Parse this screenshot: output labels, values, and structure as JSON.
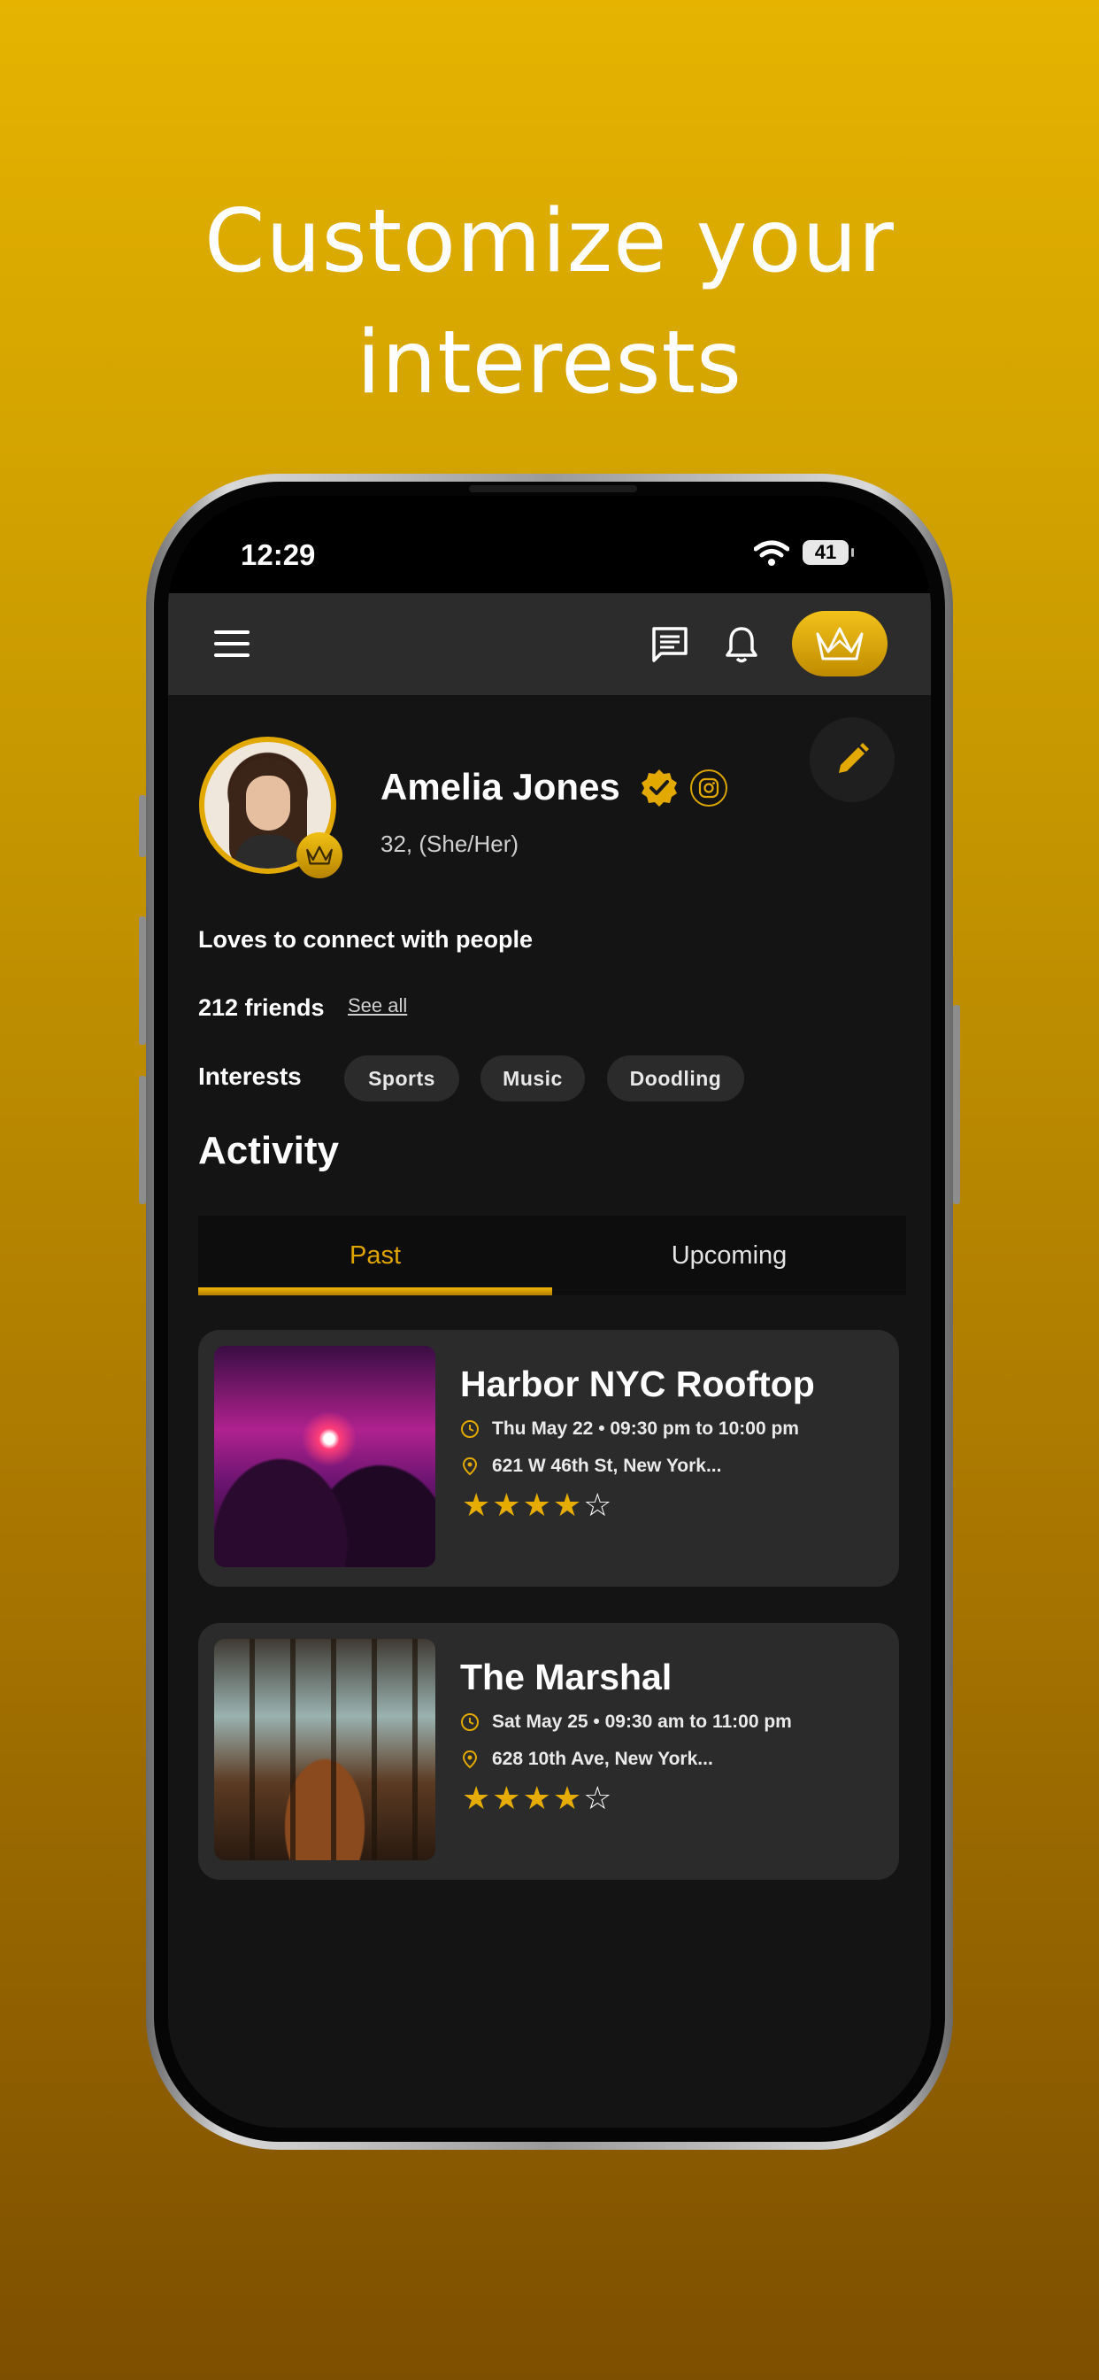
{
  "headline": {
    "line1": "Customize your",
    "line2": "interests"
  },
  "status_bar": {
    "time": "12:29",
    "battery": "41"
  },
  "app_bar": {
    "menu_icon": "menu-icon",
    "chat_icon": "chat-icon",
    "bell_icon": "bell-icon",
    "crown_icon": "crown-icon"
  },
  "profile": {
    "name": "Amelia Jones",
    "age_pronouns": "32, (She/Her)",
    "bio": "Loves to connect with people",
    "friends": "212 friends",
    "see_all": "See all",
    "interests_label": "Interests",
    "interests": [
      "Sports",
      "Music",
      "Doodling"
    ]
  },
  "activity": {
    "title": "Activity",
    "tabs": [
      {
        "label": "Past",
        "active": true
      },
      {
        "label": "Upcoming",
        "active": false
      }
    ],
    "events": [
      {
        "title": "Harbor NYC Rooftop",
        "datetime": "Thu May 22 • 09:30 pm to 10:00 pm",
        "address": "621 W 46th St, New York...",
        "rating": 4,
        "rating_max": 5
      },
      {
        "title": "The Marshal",
        "datetime": "Sat May 25 • 09:30 am to 11:00 pm",
        "address": "628 10th Ave, New York...",
        "rating": 4,
        "rating_max": 5
      }
    ]
  },
  "colors": {
    "accent": "#e2a900",
    "background": "#141414",
    "card": "#2b2b2b"
  }
}
